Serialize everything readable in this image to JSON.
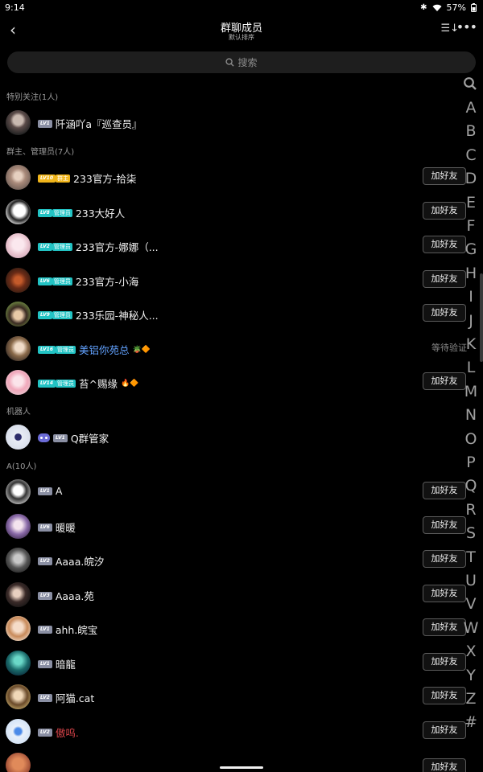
{
  "status": {
    "time": "9:14",
    "battery": "57%"
  },
  "header": {
    "title": "群聊成员",
    "subtitle": "默认排序"
  },
  "search": {
    "placeholder": "搜索"
  },
  "sections": {
    "special": "特别关注(1人)",
    "admins": "群主、管理员(7人)",
    "bots": "机器人",
    "a": "A(10人)"
  },
  "add_label": "加好友",
  "pending_label": "等待验证",
  "members": [
    {
      "name": "阡涵吖a『巡查员』",
      "level": "LV1"
    },
    {
      "name": "233官方-拾柒",
      "level": "LV10",
      "role": "群主"
    },
    {
      "name": "233大好人",
      "level": "LV8",
      "role": "管理员"
    },
    {
      "name": "233官方-娜娜（...",
      "level": "LV2",
      "role": "管理员"
    },
    {
      "name": "233官方-小海",
      "level": "LV6",
      "role": "管理员"
    },
    {
      "name": "233乐园-神秘人...",
      "level": "LV9",
      "role": "管理员"
    },
    {
      "name": "美铝你苑总",
      "level": "LV16",
      "role": "管理员"
    },
    {
      "name": "苔^赐缘",
      "level": "LV14",
      "role": "管理员"
    },
    {
      "name": "Q群管家",
      "level": "LV1"
    },
    {
      "name": "A",
      "level": "LV1"
    },
    {
      "name": "暖暖",
      "level": "LV6"
    },
    {
      "name": "Aaaa.皖汐",
      "level": "LV2"
    },
    {
      "name": "Aaaa.苑",
      "level": "LV3"
    },
    {
      "name": "ahh.皖宝",
      "level": "LV1"
    },
    {
      "name": "暗龍",
      "level": "LV1"
    },
    {
      "name": "阿猫.cat",
      "level": "LV2"
    },
    {
      "name": "傲呜.",
      "level": "LV2"
    }
  ],
  "index_letters": [
    "A",
    "B",
    "C",
    "D",
    "E",
    "F",
    "G",
    "H",
    "I",
    "J",
    "K",
    "L",
    "M",
    "N",
    "O",
    "P",
    "Q",
    "R",
    "S",
    "T",
    "U",
    "V",
    "W",
    "X",
    "Y",
    "Z",
    "#"
  ],
  "colors": {
    "owner": "#f0b51b",
    "admin": "#22c3c4",
    "blue_name": "#62a2ff",
    "red_name": "#d9444a"
  }
}
